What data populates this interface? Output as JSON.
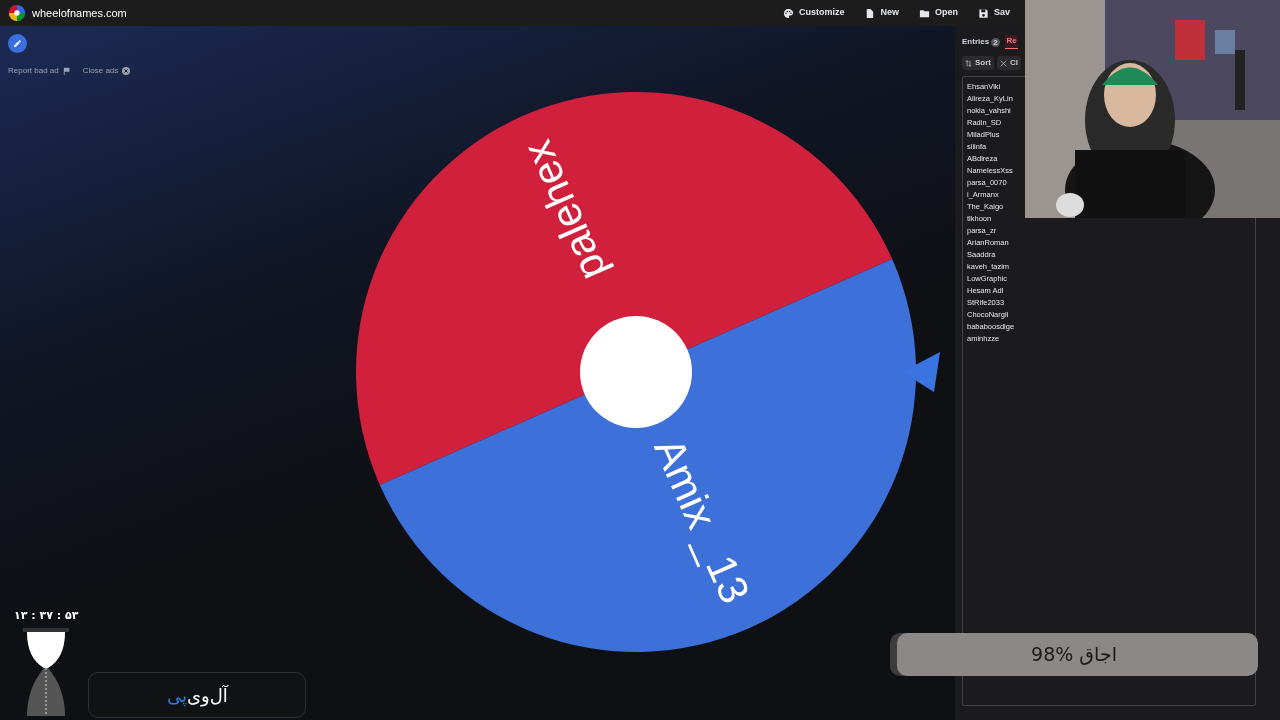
{
  "topbar": {
    "site": "wheelofnames.com",
    "actions": [
      {
        "label": "Customize",
        "kind": "palette"
      },
      {
        "label": "New",
        "kind": "file"
      },
      {
        "label": "Open",
        "kind": "folder"
      },
      {
        "label": "Sav",
        "kind": "save"
      }
    ]
  },
  "ad_links": [
    "Report bad ad",
    "Close ads"
  ],
  "wheel": {
    "slices": [
      {
        "label": "palehex",
        "color": "#d0203c"
      },
      {
        "label": "Amix _13",
        "color": "#3d70d8"
      }
    ]
  },
  "panel": {
    "tabs": [
      {
        "label": "Entries",
        "count": "2",
        "selected": false
      },
      {
        "label": "Re",
        "selected": true
      }
    ],
    "tools": [
      {
        "label": "Sort",
        "kind": "sort"
      },
      {
        "label": "Cl",
        "kind": "clear"
      }
    ],
    "entries": [
      "EhsanViki",
      "Alireza_KyLin",
      "nokia_vahshi",
      "Radin_SD",
      "MiladPlus",
      "siiinfa",
      "ABdlreza",
      "NamelessXss",
      "parsa_0070",
      "i_Armanx",
      "The_Kaigo",
      "tlkhoon",
      "parsa_zr",
      "ArianRoman",
      "Saaddra",
      "kaveh_tazim",
      "LowGraphic",
      "Hesam Adl",
      "StRife2033",
      "ChocoNargil",
      "bababoosdige",
      "aminhzze"
    ]
  },
  "clock": "۱۳ : ۳۷ : ۵۳",
  "logo_parts": [
    {
      "text": "آل‌وی",
      "color": "#ffffff"
    },
    {
      "text": "پی",
      "color": "#2f7fe0"
    }
  ],
  "progress": {
    "label": "98% اجاق",
    "level": 0.98
  }
}
